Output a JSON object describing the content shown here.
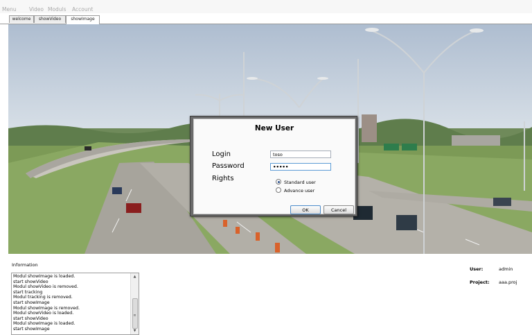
{
  "menu": [
    "Menu",
    "Video",
    "Moduls",
    "Account"
  ],
  "tabs": [
    "welcome",
    "showVideo",
    "showImage"
  ],
  "active_tab": "showImage",
  "dialog": {
    "title": "New User",
    "login_label": "Login",
    "login_value": "toso",
    "password_label": "Password",
    "password_value": "•••••",
    "rights_label": "Rights",
    "options": [
      "Standard user",
      "Advance user"
    ],
    "selected_option": "Standard user",
    "ok_label": "OK",
    "cancel_label": "Cancel"
  },
  "info": {
    "label": "Information",
    "log": [
      "Modul showImage is loaded.",
      "start showVideo",
      "Modul showVideo is removed.",
      "start tracking",
      "Modul tracking is removed.",
      "start showImage",
      "Modul showImage is removed.",
      "Modul showVideo is loaded.",
      "start showVideo",
      "Modul showImage is loaded.",
      "start showImage"
    ]
  },
  "status": {
    "user_label": "User:",
    "user_value": "admin",
    "project_label": "Project:",
    "project_value": "aaa.proj"
  },
  "icons": [
    "scroll-up-arrow-icon",
    "scroll-down-arrow-icon",
    "scroll-grip-icon"
  ]
}
